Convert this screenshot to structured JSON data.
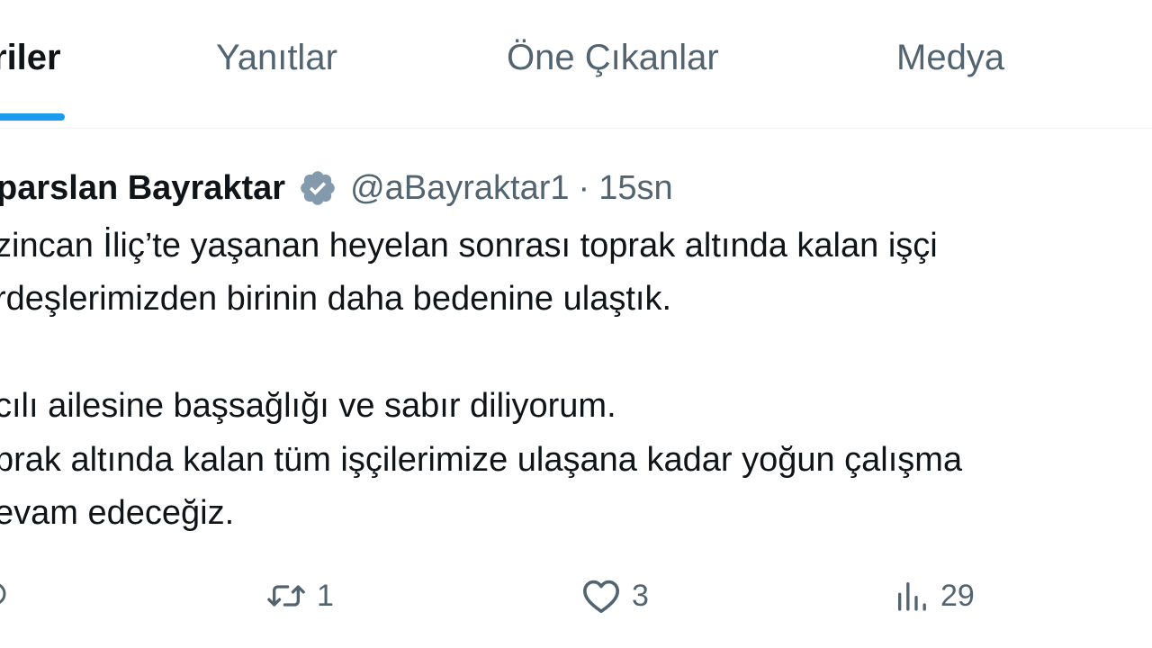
{
  "tabs": [
    {
      "label": "riler",
      "active": true
    },
    {
      "label": "Yanıtlar",
      "active": false
    },
    {
      "label": "Öne Çıkanlar",
      "active": false
    },
    {
      "label": "Medya",
      "active": false
    }
  ],
  "tweet": {
    "author_name": "parslan Bayraktar",
    "handle": "@aBayraktar1",
    "separator": "·",
    "time": "15sn",
    "lines": [
      "zincan İliç’te yaşanan heyelan sonrası toprak altında kalan işçi",
      "rdeşlerimizden birinin daha bedenine ulaştık.",
      "cılı ailesine başsağlığı ve sabır diliyorum.",
      "prak altında kalan tüm işçilerimize ulaşana kadar yoğun çalışma",
      "evam edeceğiz."
    ],
    "actions": {
      "reply_count": "",
      "retweet_count": "1",
      "like_count": "3",
      "views_count": "29"
    }
  },
  "colors": {
    "accent": "#1d9bf0",
    "text_primary": "#0f1419",
    "text_secondary": "#536471",
    "verified_badge": "#829aab"
  },
  "icons": {
    "verified": "verified-badge-icon",
    "reply": "reply-icon",
    "retweet": "retweet-icon",
    "like": "heart-icon",
    "views": "views-icon"
  }
}
